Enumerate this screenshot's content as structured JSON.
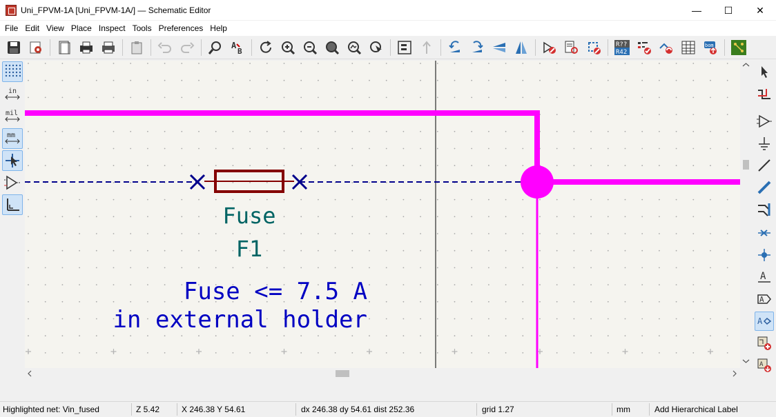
{
  "window": {
    "title": "Uni_FPVM-1A [Uni_FPVM-1A/] — Schematic Editor",
    "minimize_glyph": "—",
    "maximize_glyph": "☐",
    "close_glyph": "✕"
  },
  "menu": [
    "File",
    "Edit",
    "View",
    "Place",
    "Inspect",
    "Tools",
    "Preferences",
    "Help"
  ],
  "top_toolbar": [
    "save-icon",
    "schematic-setup-icon",
    "page-settings-icon",
    "print-icon",
    "plot-icon",
    "paste-icon",
    "undo-icon",
    "redo-icon",
    "find-icon",
    "find-replace-icon",
    "refresh-icon",
    "zoom-in-icon",
    "zoom-out-icon",
    "zoom-fit-icon",
    "zoom-objects-icon",
    "zoom-tool-icon",
    "hierarchy-navigator-icon",
    "leave-sheet-icon",
    "rotate-ccw-icon",
    "rotate-cw-icon",
    "mirror-vertical-icon",
    "mirror-horizontal-icon",
    "symbol-editor-icon",
    "symbol-browser-icon",
    "footprint-editor-icon",
    "annotate-icon",
    "erc-icon",
    "assign-footprints-icon",
    "bom-icon",
    "bom-generate-icon",
    "pcb-editor-icon"
  ],
  "toolbar_labels": {
    "annotate": "R??",
    "annotate_sub": "R42",
    "bom": "bom"
  },
  "left_toolbar": {
    "units_in": "in",
    "units_mil": "mil",
    "units_mm": "mm"
  },
  "right_toolbar": {
    "text_glyph": "A"
  },
  "schematic": {
    "fuse_value": "Fuse",
    "fuse_ref": "F1",
    "note_line1": "Fuse <= 7.5 A",
    "note_line2": "in external holder",
    "colors": {
      "canvas_bg": "#f5f4ef",
      "wire_highlight": "#ff00ff",
      "wire_dashed": "#00008b",
      "fuse_body": "#840000",
      "field_text": "#006464",
      "note_text": "#0000c2",
      "grid_dot": "#a8a8a8"
    }
  },
  "status": {
    "highlighted_net": "Highlighted net: Vin_fused",
    "zoom": "Z 5.42",
    "xy": "X 246.38  Y 54.61",
    "delta": "dx 246.38  dy 54.61  dist 252.36",
    "grid": "grid 1.27",
    "units": "mm",
    "tool": "Add Hierarchical Label"
  }
}
